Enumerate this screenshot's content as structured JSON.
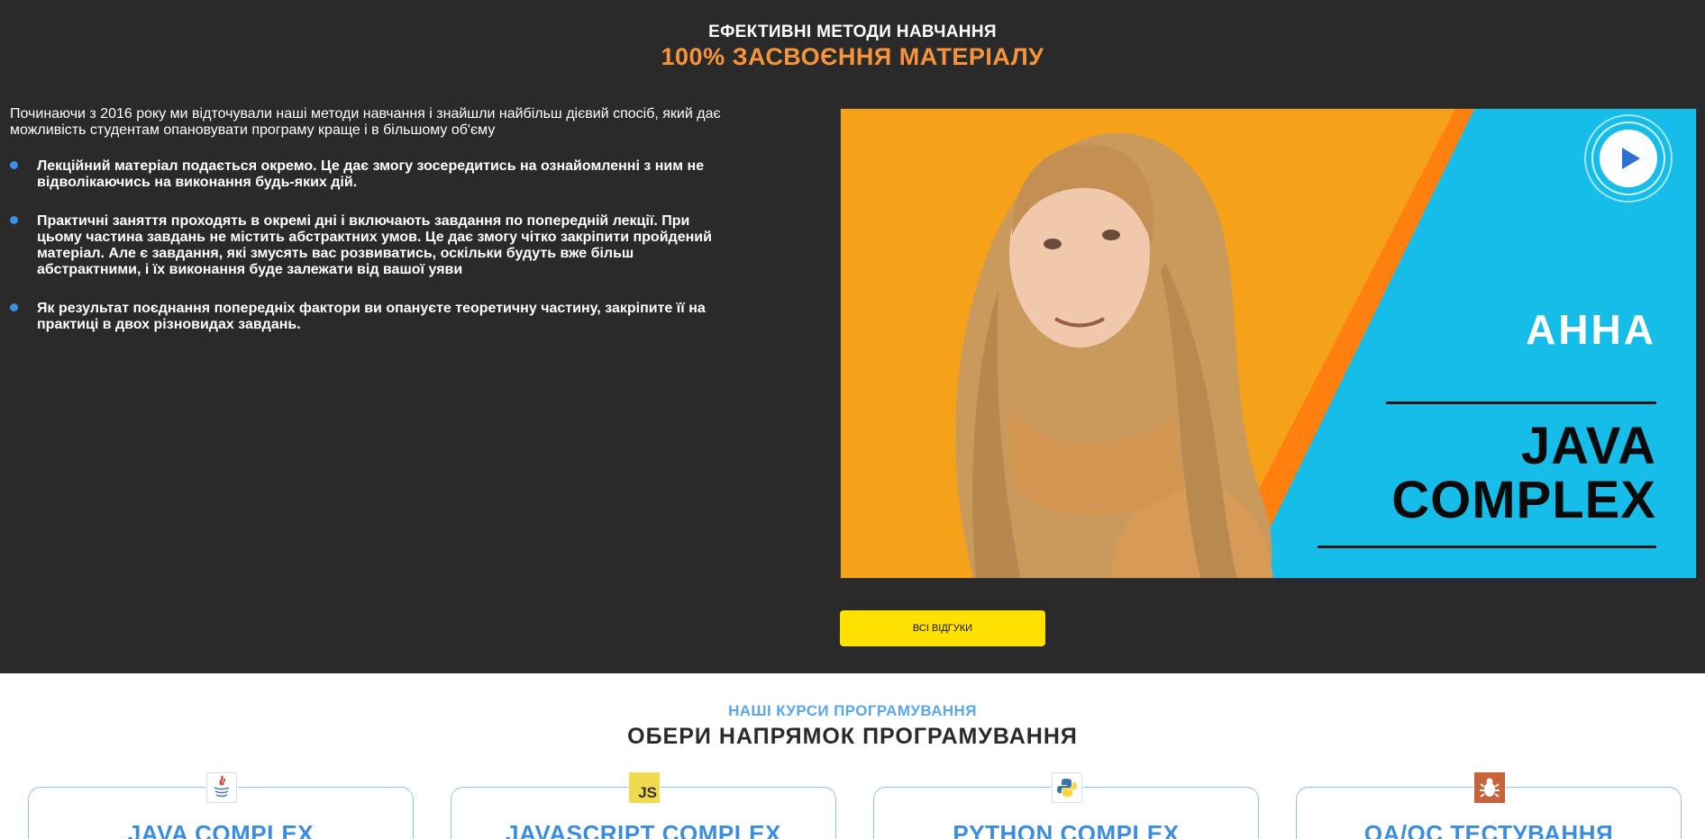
{
  "methods": {
    "eyebrow": "ЕФЕКТИВНІ МЕТОДИ НАВЧАННЯ",
    "headline": "100% ЗАСВОЄННЯ МАТЕРІАЛУ",
    "intro": "Починаючи з 2016 року ми відточували наші методи навчання і знайшли найбільш дієвий спосіб, який дає можливість студентам опановувати програму краще і в більшому об'єму",
    "bullets": [
      "Лекційний матеріал подається окремо. Це дає змогу зосередитись на ознайомленні з ним не відволікаючись на виконання будь-яких дій.",
      "Практичні заняття проходять в окремі дні і включають завдання по попередній лекції. При цьому частина завдань не містить абстрактних умов. Це дає змогу чітко закріпити пройдений матеріал. Але є завдання, які змусять вас розвиватись, оскільки будуть вже більш абстрактними, і їх виконання буде залежати від вашої уяви",
      "Як результат поєднання попередніх фактори ви опануєте теоретичну частину, закріпите її на практиці в двох різновидах завдань."
    ]
  },
  "video": {
    "name": "АННА",
    "course_line1": "JAVA",
    "course_line2": "COMPLEX",
    "play_icon": "play-icon"
  },
  "reviews_button": "ВСІ ВІДГУКИ",
  "courses": {
    "eyebrow": "НАШІ КУРСИ ПРОГРАМУВАННЯ",
    "title": "ОБЕРИ НАПРЯМОК ПРОГРАМУВАННЯ",
    "items": [
      {
        "title": "JAVA COMPLEX",
        "icon": "java-icon"
      },
      {
        "title": "JAVASCRIPT COMPLEX",
        "icon": "js-icon",
        "icon_text": "JS"
      },
      {
        "title": "PYTHON COMPLEX",
        "icon": "python-icon"
      },
      {
        "title": "QA/QC ТЕСТУВАННЯ",
        "icon": "bug-icon"
      }
    ]
  },
  "colors": {
    "dark_bg": "#2a2a2a",
    "accent_orange": "#f7943a",
    "accent_yellow": "#ffe100",
    "accent_blue": "#3a8de0"
  }
}
